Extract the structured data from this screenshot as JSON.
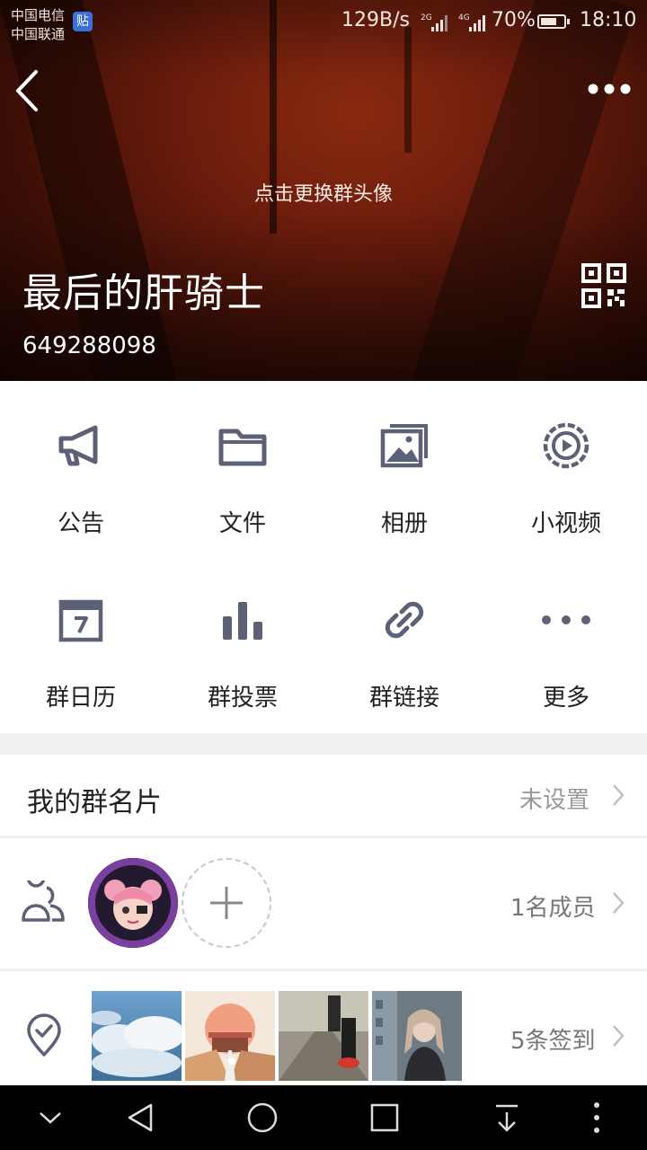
{
  "status_bar": {
    "carrier_1": "中国电信",
    "carrier_2": "中国联通",
    "tie_badge": "贴",
    "net_speed": "129B/s",
    "sim1_net": "2G",
    "sim2_net": "4G",
    "battery_text": "70%",
    "battery_level": 0.7,
    "time": "18:10"
  },
  "header": {
    "back_icon": "chevron-left-icon",
    "more_icon": "more-dots-icon",
    "change_avatar_hint": "点击更换群头像",
    "group_name": "最后的肝骑士",
    "group_id": "649288098",
    "qr_icon": "qr-code-icon"
  },
  "features": [
    {
      "label": "公告",
      "icon": "megaphone-icon"
    },
    {
      "label": "文件",
      "icon": "folder-icon"
    },
    {
      "label": "相册",
      "icon": "album-icon"
    },
    {
      "label": "小视频",
      "icon": "video-icon"
    },
    {
      "label": "群日历",
      "icon": "calendar-icon"
    },
    {
      "label": "群投票",
      "icon": "vote-chart-icon"
    },
    {
      "label": "群链接",
      "icon": "link-icon"
    },
    {
      "label": "更多",
      "icon": "more-dots-icon"
    }
  ],
  "group_card": {
    "label": "我的群名片",
    "value": "未设置"
  },
  "members": {
    "count_text": "1名成员"
  },
  "checkin": {
    "count_text": "5条签到"
  },
  "colors": {
    "icon_gray": "#5c6178",
    "accent_header": "#6a1c0c",
    "divider": "#e5e5e5"
  }
}
